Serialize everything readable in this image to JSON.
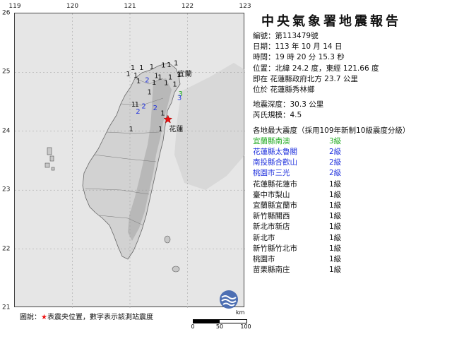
{
  "map": {
    "lon_ticks": [
      "119",
      "120",
      "121",
      "122",
      "123"
    ],
    "lat_ticks": [
      "26",
      "25",
      "24",
      "23",
      "22",
      "21"
    ],
    "epicenter": {
      "lon": 121.66,
      "lat": 24.2
    },
    "station_markers": [
      {
        "text": "1",
        "lon": 121.05,
        "lat": 25.04
      },
      {
        "text": "1",
        "lon": 121.2,
        "lat": 25.04
      },
      {
        "text": "1",
        "lon": 121.38,
        "lat": 25.05
      },
      {
        "text": "1",
        "lon": 121.58,
        "lat": 25.08
      },
      {
        "text": "1",
        "lon": 121.68,
        "lat": 25.09
      },
      {
        "text": "1",
        "lon": 121.8,
        "lat": 25.12
      },
      {
        "text": "1",
        "lon": 120.97,
        "lat": 24.93
      },
      {
        "text": "1",
        "lon": 121.1,
        "lat": 24.91
      },
      {
        "text": "1",
        "lon": 121.46,
        "lat": 24.9
      },
      {
        "text": "1",
        "lon": 121.52,
        "lat": 24.88
      },
      {
        "text": "1",
        "lon": 121.7,
        "lat": 24.88
      },
      {
        "text": "1",
        "lon": 121.85,
        "lat": 24.92
      },
      {
        "text": "2",
        "lon": 121.3,
        "lat": 24.83,
        "color": "#2233dd"
      },
      {
        "text": "1",
        "lon": 121.15,
        "lat": 24.81
      },
      {
        "text": "1",
        "lon": 121.42,
        "lat": 24.79
      },
      {
        "text": "1",
        "lon": 121.63,
        "lat": 24.78
      },
      {
        "text": "1",
        "lon": 121.78,
        "lat": 24.76
      },
      {
        "text": "1",
        "lon": 121.34,
        "lat": 24.63
      },
      {
        "text": "3",
        "lon": 121.88,
        "lat": 24.6,
        "color": "#22aa22"
      },
      {
        "text": "3",
        "lon": 121.86,
        "lat": 24.53,
        "color": "#2233dd"
      },
      {
        "text": "1",
        "lon": 121.06,
        "lat": 24.42
      },
      {
        "text": "1",
        "lon": 121.12,
        "lat": 24.42
      },
      {
        "text": "2",
        "lon": 121.24,
        "lat": 24.39,
        "color": "#2233dd"
      },
      {
        "text": "2",
        "lon": 121.44,
        "lat": 24.36,
        "color": "#2233dd"
      },
      {
        "text": "2",
        "lon": 121.14,
        "lat": 24.3,
        "color": "#2233dd"
      },
      {
        "text": "1",
        "lon": 121.57,
        "lat": 24.27
      },
      {
        "text": "1",
        "lon": 121.02,
        "lat": 24.0
      },
      {
        "text": "1",
        "lon": 121.53,
        "lat": 24.0
      }
    ],
    "city_labels": [
      {
        "text": "宜蘭",
        "lon": 121.83,
        "lat": 24.93
      },
      {
        "text": "花蓮",
        "lon": 121.68,
        "lat": 24.0
      }
    ]
  },
  "legend": {
    "prefix": "圖說：",
    "star": "★",
    "text": "表震央位置，數字表示該測站震度"
  },
  "scalebar": {
    "unit": "km",
    "ticks": [
      "0",
      "50",
      "100"
    ]
  },
  "report": {
    "title": "中央氣象署地震報告",
    "number_label": "編號：",
    "number": "第113479號",
    "date_label": "日期：",
    "date": "113 年 10 月 14 日",
    "time_label": "時間：",
    "time": "19 時 20 分 15.3 秒",
    "position_label": "位置：",
    "position": "北緯 24.2 度，東經 121.66 度",
    "position_line2": "即在 花蓮縣政府北方 23.7 公里",
    "position_line3": "位於 花蓮縣秀林鄉",
    "depth_label": "地震深度：",
    "depth": "30.3 公里",
    "magnitude_label": "芮氏規模：",
    "magnitude": "4.5",
    "max_intensity_heading": "各地最大震度（採用109年新制10級震度分級）"
  },
  "stations": [
    {
      "name": "宜蘭縣南澳",
      "intensity": "3級",
      "color": "#22aa22"
    },
    {
      "name": "花蓮縣太魯閣",
      "intensity": "2級",
      "color": "#2233dd"
    },
    {
      "name": "南投縣合歡山",
      "intensity": "2級",
      "color": "#2233dd"
    },
    {
      "name": "桃園市三光",
      "intensity": "2級",
      "color": "#2233dd"
    },
    {
      "name": "花蓮縣花蓮市",
      "intensity": "1級",
      "color": "#111111"
    },
    {
      "name": "臺中市梨山",
      "intensity": "1級",
      "color": "#111111"
    },
    {
      "name": "宜蘭縣宜蘭市",
      "intensity": "1級",
      "color": "#111111"
    },
    {
      "name": "新竹縣關西",
      "intensity": "1級",
      "color": "#111111"
    },
    {
      "name": "新北市新店",
      "intensity": "1級",
      "color": "#111111"
    },
    {
      "name": "新北市",
      "intensity": "1級",
      "color": "#111111"
    },
    {
      "name": "新竹縣竹北市",
      "intensity": "1級",
      "color": "#111111"
    },
    {
      "name": "桃園市",
      "intensity": "1級",
      "color": "#111111"
    },
    {
      "name": "苗栗縣南庄",
      "intensity": "1級",
      "color": "#111111"
    }
  ]
}
